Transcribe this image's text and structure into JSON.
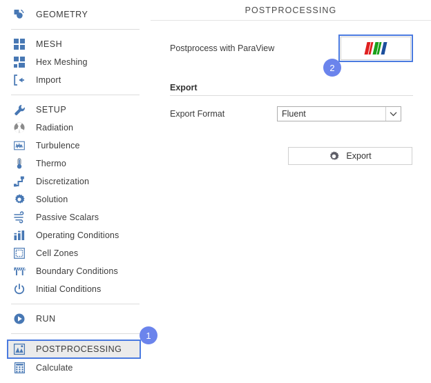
{
  "sidebar": {
    "groups": [
      {
        "items": [
          {
            "label": "GEOMETRY",
            "icon": "geometry-icon",
            "caps": true,
            "selected": false
          }
        ]
      },
      {
        "items": [
          {
            "label": "MESH",
            "icon": "mesh-icon",
            "caps": true,
            "selected": false
          },
          {
            "label": "Hex Meshing",
            "icon": "hex-meshing-icon",
            "caps": false,
            "selected": false
          },
          {
            "label": "Import",
            "icon": "import-icon",
            "caps": false,
            "selected": false
          }
        ]
      },
      {
        "items": [
          {
            "label": "SETUP",
            "icon": "wrench-icon",
            "caps": true,
            "selected": false
          },
          {
            "label": "Radiation",
            "icon": "radiation-icon",
            "caps": false,
            "selected": false
          },
          {
            "label": "Turbulence",
            "icon": "turbulence-icon",
            "caps": false,
            "selected": false
          },
          {
            "label": "Thermo",
            "icon": "thermometer-icon",
            "caps": false,
            "selected": false
          },
          {
            "label": "Discretization",
            "icon": "discretization-icon",
            "caps": false,
            "selected": false
          },
          {
            "label": "Solution",
            "icon": "gear-icon",
            "caps": false,
            "selected": false
          },
          {
            "label": "Passive Scalars",
            "icon": "passive-scalars-icon",
            "caps": false,
            "selected": false
          },
          {
            "label": "Operating Conditions",
            "icon": "bar-chart-icon",
            "caps": false,
            "selected": false
          },
          {
            "label": "Cell Zones",
            "icon": "cell-zones-icon",
            "caps": false,
            "selected": false
          },
          {
            "label": "Boundary Conditions",
            "icon": "boundary-conditions-icon",
            "caps": false,
            "selected": false
          },
          {
            "label": "Initial Conditions",
            "icon": "power-icon",
            "caps": false,
            "selected": false
          }
        ]
      },
      {
        "items": [
          {
            "label": "RUN",
            "icon": "play-icon",
            "caps": true,
            "selected": false
          }
        ]
      },
      {
        "items": [
          {
            "label": "POSTPROCESSING",
            "icon": "postprocessing-icon",
            "caps": true,
            "selected": true
          },
          {
            "label": "Calculate",
            "icon": "calculator-icon",
            "caps": false,
            "selected": false
          }
        ]
      }
    ]
  },
  "main": {
    "title": "POSTPROCESSING",
    "paraview": {
      "label": "Postprocess with ParaView",
      "button_icon": "paraview-logo-icon"
    },
    "export": {
      "section_title": "Export",
      "format_label": "Export Format",
      "format_value": "Fluent",
      "format_options": [
        "Fluent"
      ],
      "button_label": "Export",
      "button_icon": "gear-icon"
    }
  },
  "badges": {
    "one": "1",
    "two": "2"
  },
  "colors": {
    "accent_blue": "#4878b4",
    "highlight_blue": "#4a7ae0",
    "badge_blue": "#6b84ec",
    "paraview_red": "#e02020",
    "paraview_green": "#1aa11a",
    "paraview_blue": "#1c4f9c"
  }
}
